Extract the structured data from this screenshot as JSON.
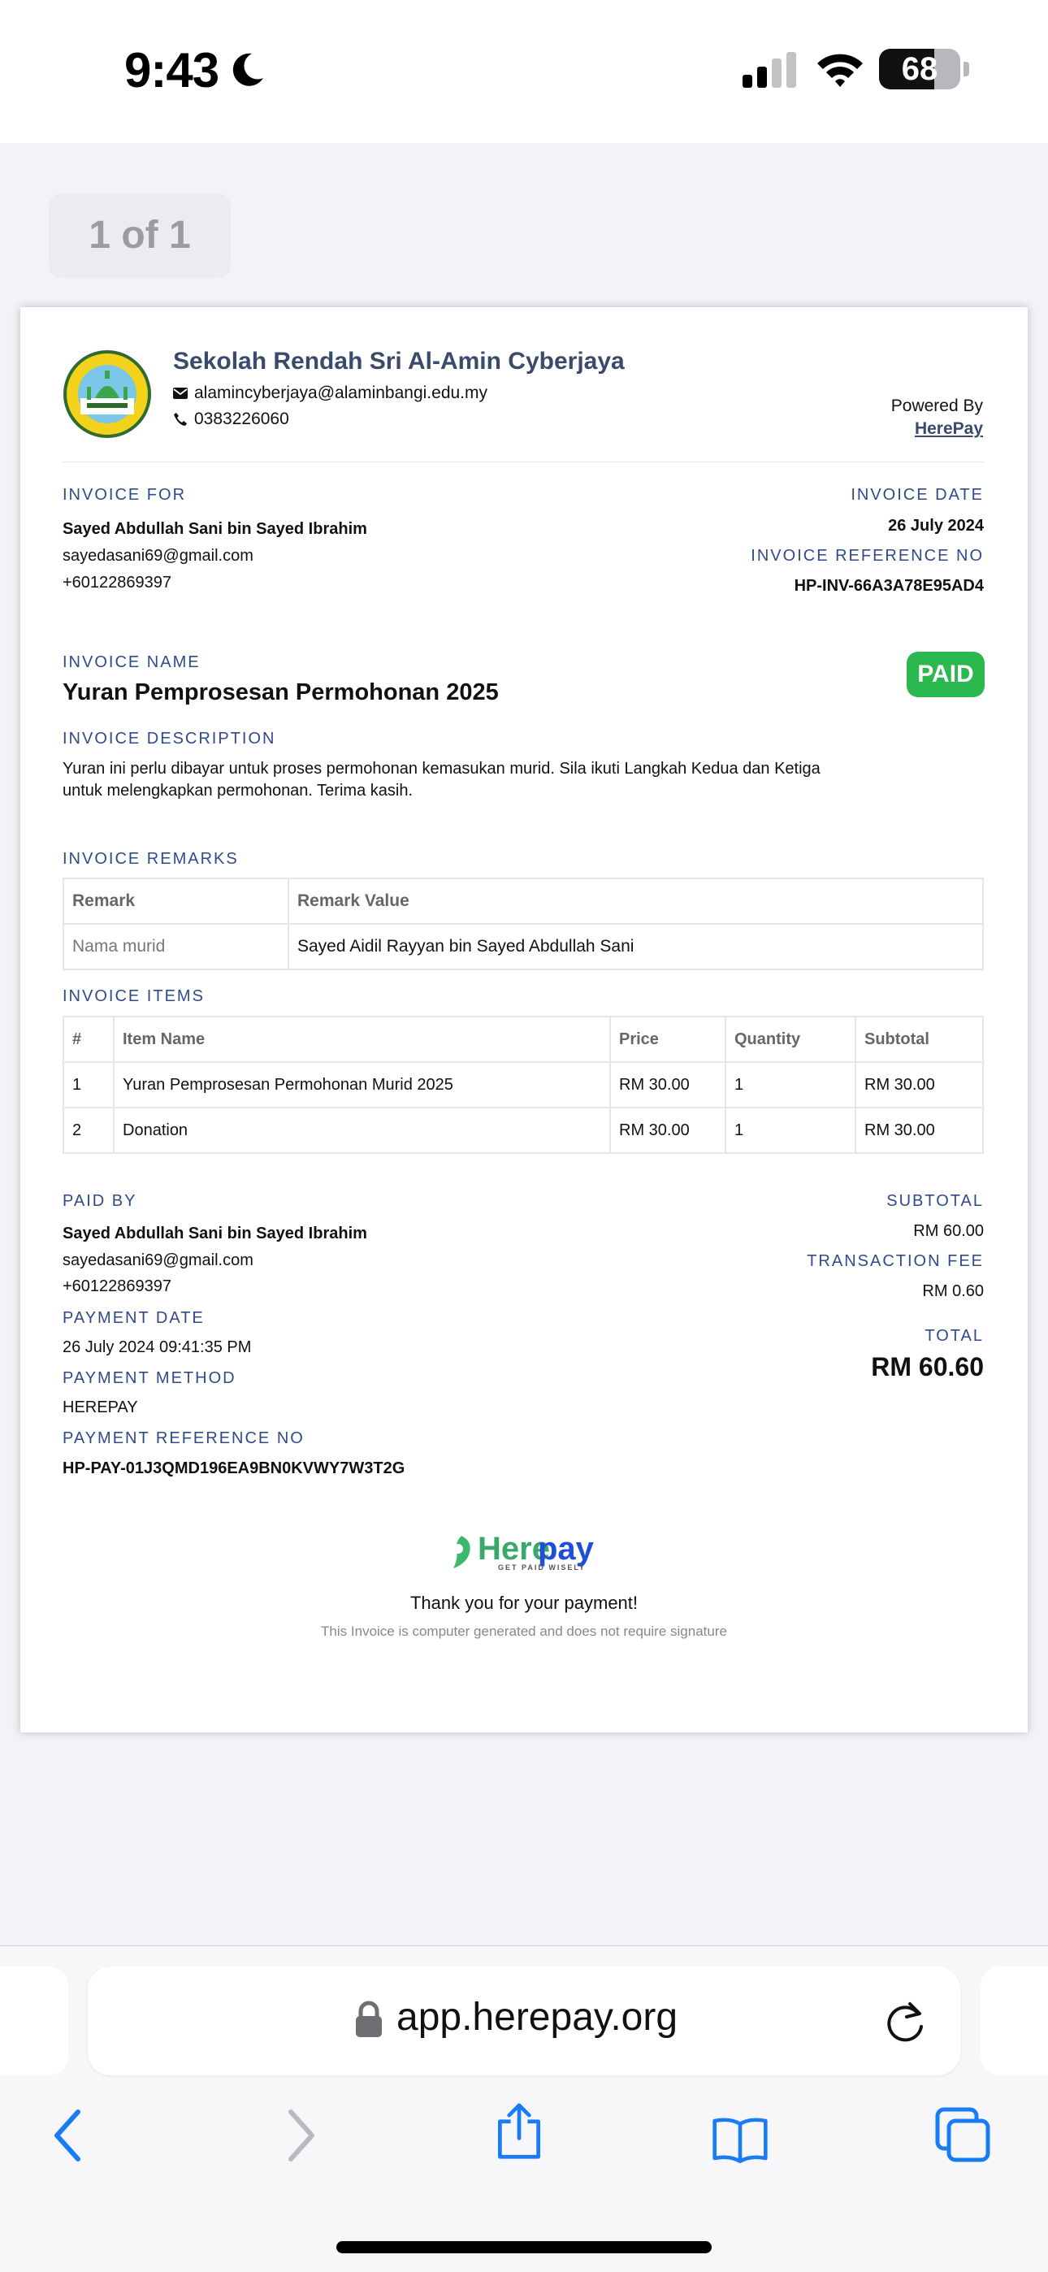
{
  "status_bar": {
    "time": "9:43",
    "battery": "68",
    "battery_level": 0.68
  },
  "page_indicator": "1 of 1",
  "school": {
    "name": "Sekolah Rendah Sri Al-Amin Cyberjaya",
    "email": "alamincyberjaya@alaminbangi.edu.my",
    "phone": "0383226060"
  },
  "powered_by": {
    "label": "Powered By",
    "link": "HerePay"
  },
  "invoice_for": {
    "label": "INVOICE FOR",
    "name": "Sayed Abdullah Sani bin Sayed Ibrahim",
    "email": "sayedasani69@gmail.com",
    "phone": "+60122869397"
  },
  "invoice_date": {
    "label": "INVOICE DATE",
    "value": "26 July 2024"
  },
  "invoice_ref": {
    "label": "INVOICE REFERENCE NO",
    "value": "HP-INV-66A3A78E95AD4"
  },
  "invoice_name": {
    "label": "INVOICE NAME",
    "value": "Yuran Pemprosesan Permohonan 2025"
  },
  "status_badge": "PAID",
  "invoice_description": {
    "label": "INVOICE DESCRIPTION",
    "line1": "Yuran ini perlu dibayar untuk proses permohonan kemasukan murid. Sila ikuti Langkah Kedua dan Ketiga",
    "line2": "untuk melengkapkan permohonan. Terima kasih."
  },
  "remarks": {
    "label": "INVOICE REMARKS",
    "headers": [
      "Remark",
      "Remark Value"
    ],
    "rows": [
      [
        "Nama murid",
        "Sayed Aidil Rayyan bin Sayed Abdullah Sani"
      ]
    ]
  },
  "items": {
    "label": "INVOICE ITEMS",
    "headers": [
      "#",
      "Item Name",
      "Price",
      "Quantity",
      "Subtotal"
    ],
    "rows": [
      [
        "1",
        "Yuran Pemprosesan Permohonan Murid 2025",
        "RM 30.00",
        "1",
        "RM 30.00"
      ],
      [
        "2",
        "Donation",
        "RM 30.00",
        "1",
        "RM 30.00"
      ]
    ]
  },
  "paid_by": {
    "label": "PAID BY",
    "name": "Sayed Abdullah Sani bin Sayed Ibrahim",
    "email": "sayedasani69@gmail.com",
    "phone": "+60122869397"
  },
  "payment_date": {
    "label": "PAYMENT DATE",
    "value": "26 July 2024 09:41:35 PM"
  },
  "payment_method": {
    "label": "PAYMENT METHOD",
    "value": "HEREPAY"
  },
  "payment_ref": {
    "label": "PAYMENT REFERENCE NO",
    "value": "HP-PAY-01J3QMD196EA9BN0KVWY7W3T2G"
  },
  "totals": {
    "subtotal_label": "SUBTOTAL",
    "subtotal": "RM 60.00",
    "fee_label": "TRANSACTION FEE",
    "fee": "RM 0.60",
    "total_label": "TOTAL",
    "total": "RM 60.60"
  },
  "brand": {
    "name_part1": "Here",
    "name_part2": "pay",
    "tagline": "GET PAID WISELY"
  },
  "footer": {
    "thanks": "Thank you for your payment!",
    "note": "This Invoice is computer generated and does not require signature"
  },
  "browser": {
    "url": "app.herepay.org"
  },
  "colors": {
    "accent": "#2f4b8a",
    "paid": "#2bb84e",
    "ios_blue": "#1a7cf5"
  }
}
